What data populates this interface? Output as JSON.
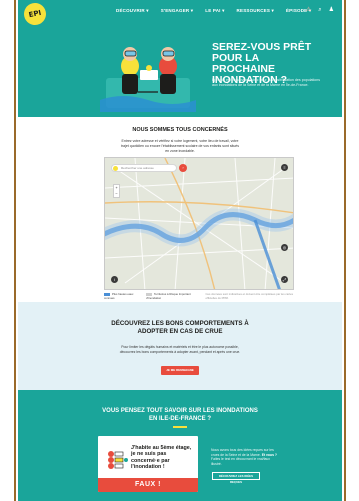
{
  "logo": {
    "text": "EPI"
  },
  "nav": {
    "items": [
      "DÉCOUVRIR ▾",
      "S'ENGAGER ▾",
      "LE PAI ▾",
      "RESSOURCES ▾",
      "ÉPISODE ▾"
    ],
    "icons": [
      "alert-icon",
      "search-icon",
      "user-icon"
    ],
    "alert_glyph": "⚠",
    "search_glyph": "⌕",
    "user_glyph": "♟"
  },
  "hero": {
    "title": "SEREZ-VOUS PRÊT POUR LA PROCHAINE INONDATION ?",
    "text": "Épisode est un service public pour la sensibilisation des populations aux inondations de la Seine et de la Marne en Île-de-France."
  },
  "concern": {
    "title": "NOUS SOMMES TOUS CONCERNÉS",
    "text": "Entrez votre adresse et vérifiez si votre logement, votre lieu de travail, votre trajet quotidien ou encore l'établissement scolaire de vos enfants sont situés en zone inondable.",
    "search_placeholder": "Rechercher une adresse",
    "go_glyph": "›",
    "zoom_plus": "+",
    "zoom_minus": "−",
    "legend": [
      {
        "label": "Plus hautes eaux connues",
        "color": "#4a8fd6"
      },
      {
        "label": "Territoires à Risque Important d'Inondation",
        "color": "#cfcfcf"
      }
    ],
    "legend_note": "Ces données sont indicatives et doivent être complétées par les cartes officielles du PPRI."
  },
  "behave": {
    "title": "DÉCOUVREZ LES BONS COMPORTEMENTS À ADOPTER EN CAS DE CRUE",
    "text": "Pour limiter les dégâts humains et matériels et être le plus autonome possible, découvrez les bons comportements à adopter avant, pendant et après une crue.",
    "button": "JE ME RENSEIGNE"
  },
  "quiz": {
    "title": "VOUS PENSEZ TOUT SAVOIR SUR LES INONDATIONS EN ILE-DE-FRANCE ?",
    "card_text": "J'habite au 5ème étage, je ne suis pas concerné·e par l'inondation !",
    "card_answer": "FAUX !",
    "side_text_1": "Nous avons tous des idées reçues sur les crues de la Seine et de la Marne.",
    "side_text_bold": "Et vous ?",
    "side_text_2": "Faites le test en découvrant le vrai/faux illustré.",
    "button": "DÉCOUVREZ LES IDÉES REÇUES"
  },
  "colors": {
    "brand_teal": "#1aa59a",
    "accent_yellow": "#f7e13b",
    "accent_red": "#e84c3d",
    "light_blue": "#e3f1f6"
  }
}
